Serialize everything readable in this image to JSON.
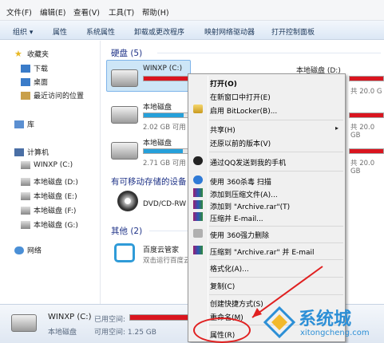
{
  "menubar": [
    "文件(F)",
    "编辑(E)",
    "查看(V)",
    "工具(T)",
    "帮助(H)"
  ],
  "toolbar": [
    "组织 ▾",
    "属性",
    "系统属性",
    "卸载或更改程序",
    "映射网络驱动器",
    "打开控制面板"
  ],
  "sidebar": {
    "favorites": "收藏夹",
    "fav_items": [
      "下载",
      "桌面",
      "最近访问的位置"
    ],
    "library": "库",
    "computer": "计算机",
    "drives": [
      "WINXP (C:)",
      "本地磁盘 (D:)",
      "本地磁盘 (E:)",
      "本地磁盘 (F:)",
      "本地磁盘 (G:)"
    ],
    "network": "网络"
  },
  "main": {
    "hdd_group": "硬盘 (5)",
    "drives": [
      {
        "name": "WINXP (C:)",
        "free": ""
      },
      {
        "name": "本地磁盘 (D:)",
        "free": "共 20.0 G"
      },
      {
        "name": "本地磁盘",
        "free": "2.02 GB 可用"
      },
      {
        "name": "本地磁盘",
        "free": "2.71 GB 可用"
      }
    ],
    "free_right": [
      "共 20.0 GB",
      "共 20.0 GB"
    ],
    "removable_group": "有可移动存储的设备",
    "dvd": "DVD/CD-RW",
    "other_group": "其他 (2)",
    "baidu": "百度云管家",
    "baidu_sub": "双击运行百度云"
  },
  "status": {
    "name": "WINXP (C:)",
    "used_label": "已用空间:",
    "type": "本地磁盘",
    "free_label": "可用空间: 1.25 GB"
  },
  "context_menu": {
    "items": [
      "打开(O)",
      "在新窗口中打开(E)",
      "启用 BitLocker(B)...",
      "共享(H)",
      "还原以前的版本(V)",
      "通过QQ发送到我的手机",
      "使用 360杀毒 扫描",
      "添加到压缩文件(A)...",
      "添加到 \"Archive.rar\"(T)",
      "压缩并 E-mail...",
      "使用 360强力删除",
      "压缩到 \"Archive.rar\" 并 E-mail",
      "格式化(A)...",
      "复制(C)",
      "创建快捷方式(S)",
      "重命名(M)",
      "属性(R)"
    ]
  },
  "watermark": {
    "text": "系统城",
    "url": "xitongcheng.com"
  }
}
